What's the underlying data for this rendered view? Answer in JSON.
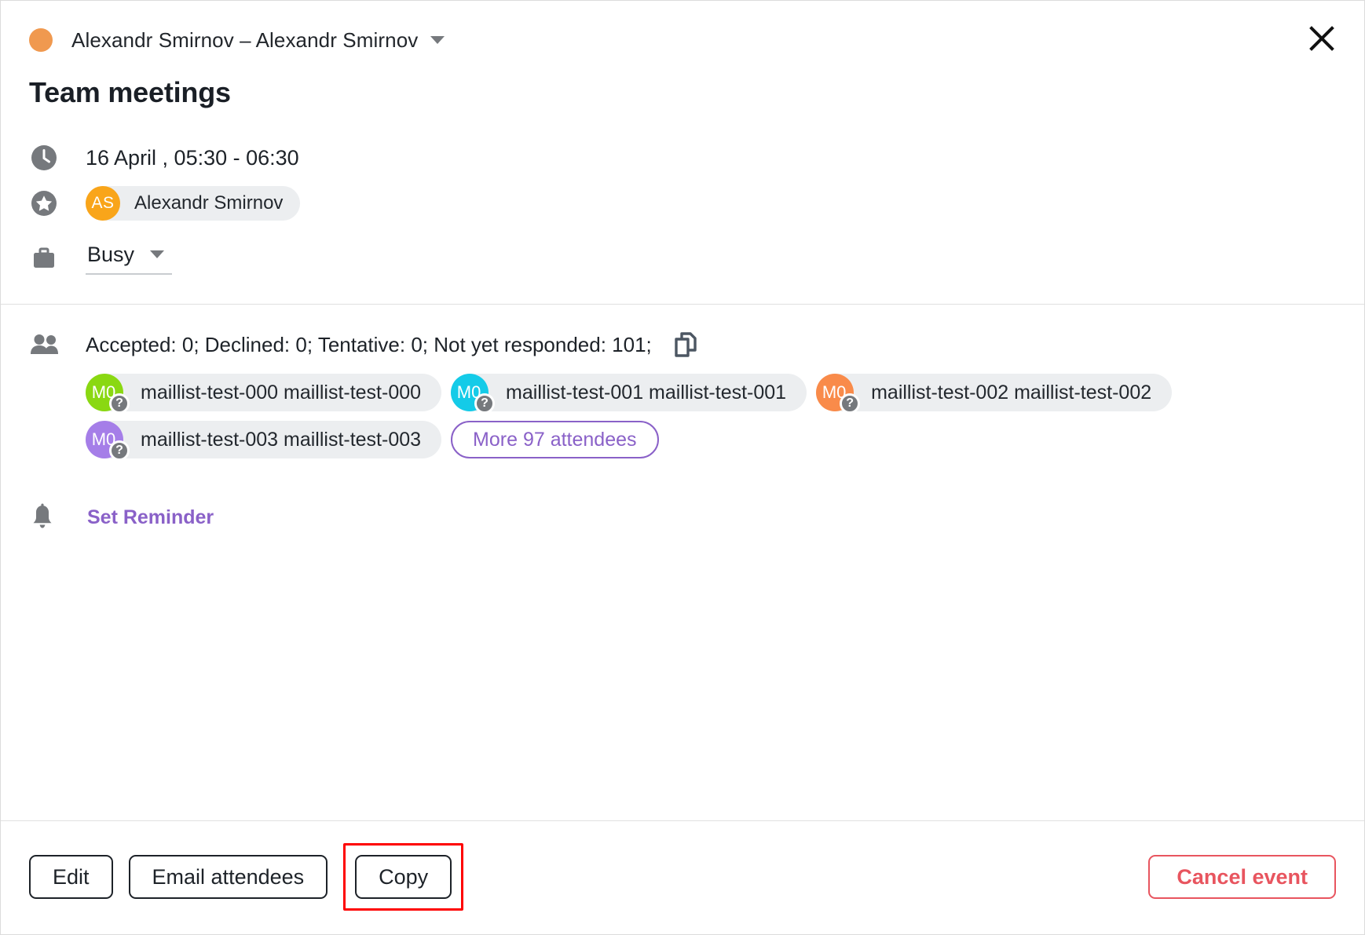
{
  "header": {
    "calendar_owner": "Alexandr Smirnov – Alexandr Smirnov",
    "calendar_dot_color": "#f0994f",
    "dropdown_icon": "chevron-down-icon",
    "close_icon": "close-icon",
    "event_title": "Team meetings"
  },
  "details": {
    "time_icon": "clock-icon",
    "datetime": "16 April , 05:30 - 06:30",
    "organizer_icon": "star-icon",
    "organizer": {
      "initials": "AS",
      "name": "Alexandr Smirnov",
      "avatar_color": "#f9a51a"
    },
    "availability_icon": "briefcase-icon",
    "availability": "Busy"
  },
  "attendees": {
    "people_icon": "people-icon",
    "summary": "Accepted: 0; Declined: 0; Tentative: 0; Not yet responded: 101;",
    "copy_icon": "copy-icon",
    "list": [
      {
        "initials": "M0",
        "name": "maillist-test-000 maillist-test-000",
        "avatar_color": "#8ad812",
        "status": "?"
      },
      {
        "initials": "M0",
        "name": "maillist-test-001 maillist-test-001",
        "avatar_color": "#14cbe8",
        "status": "?"
      },
      {
        "initials": "M0",
        "name": "maillist-test-002 maillist-test-002",
        "avatar_color": "#f98b4a",
        "status": "?"
      },
      {
        "initials": "M0",
        "name": "maillist-test-003 maillist-test-003",
        "avatar_color": "#a57ee8",
        "status": "?"
      }
    ],
    "more_label": "More 97 attendees"
  },
  "reminder": {
    "bell_icon": "bell-icon",
    "label": "Set Reminder"
  },
  "footer": {
    "edit_label": "Edit",
    "email_attendees_label": "Email attendees",
    "copy_label": "Copy",
    "cancel_event_label": "Cancel event",
    "highlight_color": "#fe0000"
  }
}
